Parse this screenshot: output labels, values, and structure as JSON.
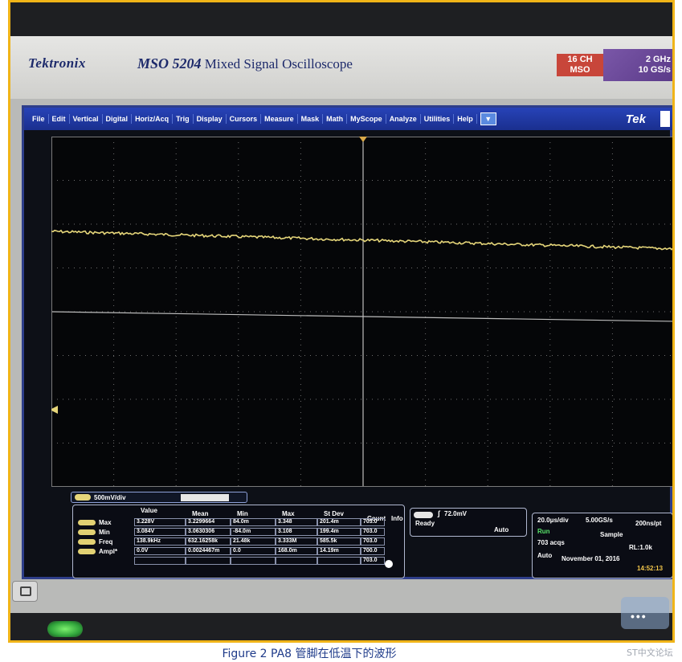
{
  "instrument": {
    "brand": "Tektronix",
    "model": "MSO 5204",
    "model_desc": "Mixed Signal Oscilloscope",
    "badge_ch_line1": "16 CH",
    "badge_ch_line2": "MSO",
    "badge_bw_line1": "2 GHz",
    "badge_bw_line2": "10 GS/s"
  },
  "menu": {
    "items": [
      "File",
      "Edit",
      "Vertical",
      "Digital",
      "Horiz/Acq",
      "Trig",
      "Display",
      "Cursors",
      "Measure",
      "Mask",
      "Math",
      "MyScope",
      "Analyze",
      "Utilities",
      "Help"
    ],
    "dropdown_glyph": "▼",
    "logo": "Tek"
  },
  "channel": {
    "scale": "500mV/div",
    "color": "#e6d67a"
  },
  "measurements": {
    "headers": [
      "Value",
      "Mean",
      "Min",
      "Max",
      "St Dev",
      "Count",
      "Info"
    ],
    "rows": [
      {
        "name": "Max",
        "cells": [
          "3.228V",
          "3.2299664",
          "84.0m",
          "3.348",
          "201.4m",
          "703.0"
        ]
      },
      {
        "name": "Min",
        "cells": [
          "3.084V",
          "3.0630306",
          "-84.0m",
          "3.108",
          "199.4m",
          "703.0"
        ]
      },
      {
        "name": "Freq",
        "cells": [
          "138.9kHz",
          "632.16258k",
          "21.48k",
          "3.333M",
          "585.5k",
          "703.0"
        ]
      },
      {
        "name": "Ampl*",
        "cells": [
          "0.0V",
          "0.0024467m",
          "0.0",
          "168.0m",
          "14.19m",
          "700.0"
        ]
      },
      {
        "name": "",
        "cells": [
          "",
          "",
          "",
          "",
          "",
          "703.0"
        ]
      }
    ]
  },
  "trigger": {
    "edge": "∫",
    "level": "72.0mV",
    "state": "Ready",
    "mode": "Auto"
  },
  "acquisition": {
    "timebase": "20.0μs/div",
    "sample_rate": "5.00GS/s",
    "resolution": "200ns/pt",
    "run_state": "Run",
    "sample_mode": "Sample",
    "acqs": "703 acqs",
    "record_length": "RL:1.0k",
    "trigger_mode": "Auto",
    "date": "November 01, 2016",
    "time": "14:52:13"
  },
  "caption": "Figure 2 PA8 管脚在低温下的波形",
  "watermark": "ST中文论坛"
}
